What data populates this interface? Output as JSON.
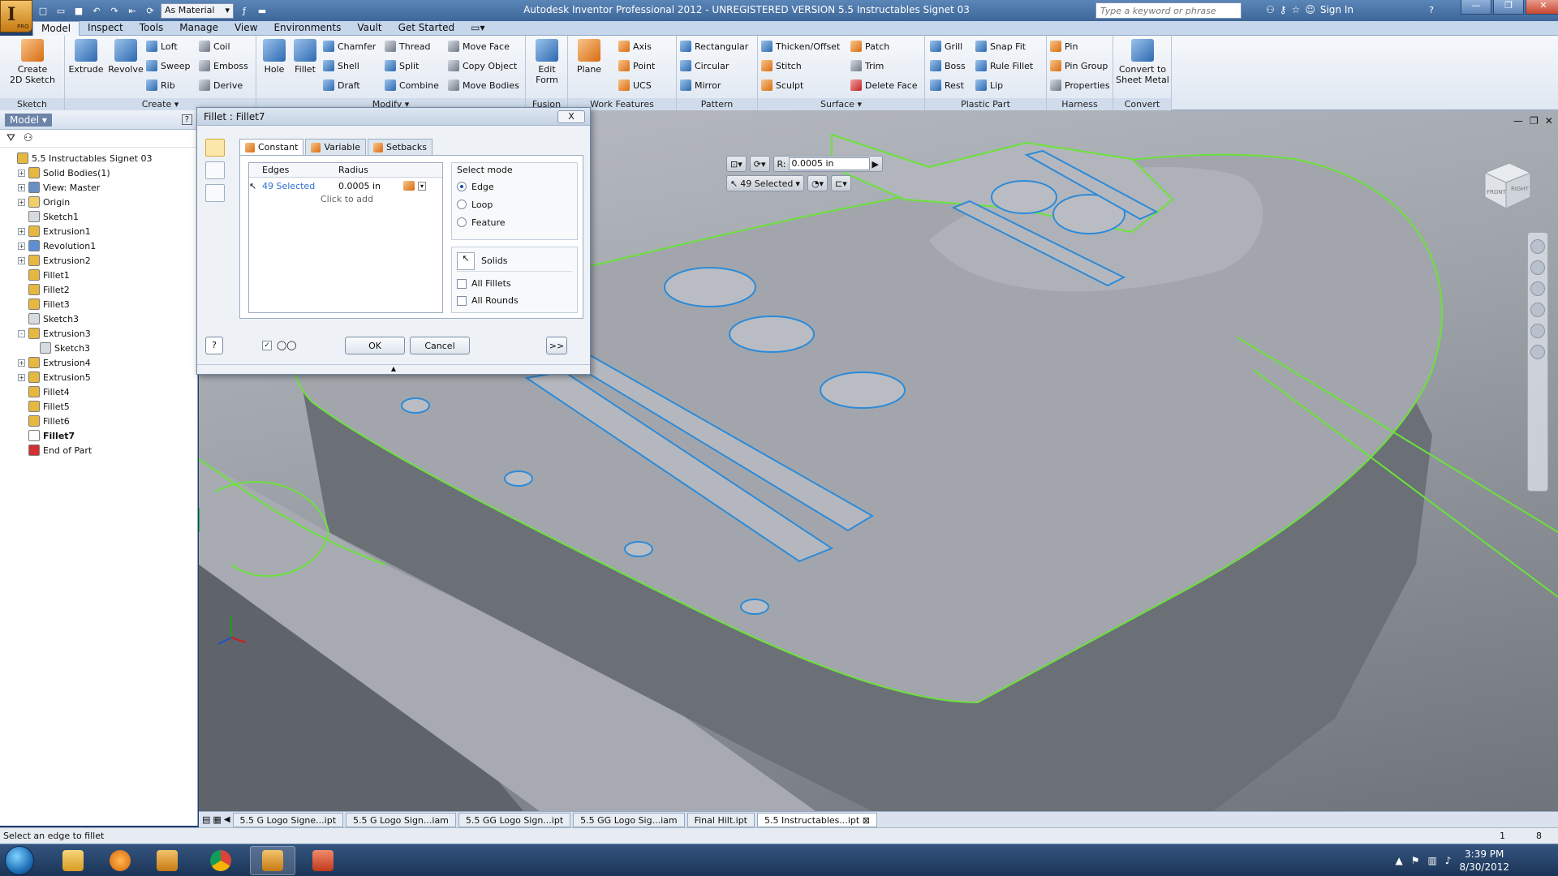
{
  "app": {
    "menu_letter": "I",
    "menu_badge": "PRO",
    "title": "Autodesk Inventor Professional 2012 - UNREGISTERED VERSION   5.5 Instructables Signet 03",
    "material": "As Material",
    "search_placeholder": "Type a keyword or phrase",
    "sign_in": "Sign In"
  },
  "ribbon_tabs": [
    "Model",
    "Inspect",
    "Tools",
    "Manage",
    "View",
    "Environments",
    "Vault",
    "Get Started"
  ],
  "ribbon": {
    "sketch": {
      "title": "Sketch",
      "create_line1": "Create",
      "create_line2": "2D Sketch"
    },
    "create": {
      "title": "Create",
      "extrude": "Extrude",
      "revolve": "Revolve",
      "loft": "Loft",
      "sweep": "Sweep",
      "rib": "Rib",
      "coil": "Coil",
      "emboss": "Emboss",
      "derive": "Derive"
    },
    "modify": {
      "title": "Modify",
      "hole": "Hole",
      "fillet": "Fillet",
      "chamfer": "Chamfer",
      "shell": "Shell",
      "draft": "Draft",
      "thread": "Thread",
      "split": "Split",
      "combine": "Combine",
      "move_face": "Move Face",
      "copy_object": "Copy Object",
      "move_bodies": "Move Bodies"
    },
    "fusion": {
      "title": "Fusion",
      "edit_form_line1": "Edit",
      "edit_form_line2": "Form"
    },
    "work_features": {
      "title": "Work Features",
      "plane": "Plane",
      "axis": "Axis",
      "point": "Point",
      "ucs": "UCS"
    },
    "pattern": {
      "title": "Pattern",
      "rectangular": "Rectangular",
      "circular": "Circular",
      "mirror": "Mirror"
    },
    "surface": {
      "title": "Surface",
      "thicken": "Thicken/Offset",
      "stitch": "Stitch",
      "sculpt": "Sculpt",
      "patch": "Patch",
      "trim": "Trim",
      "delete_face": "Delete Face"
    },
    "plastic_part": {
      "title": "Plastic Part",
      "grill": "Grill",
      "boss": "Boss",
      "rest": "Rest",
      "snap_fit": "Snap Fit",
      "rule_fillet": "Rule Fillet",
      "lip": "Lip"
    },
    "harness": {
      "title": "Harness",
      "pin": "Pin",
      "pin_group": "Pin Group",
      "properties": "Properties"
    },
    "convert": {
      "title": "Convert",
      "line1": "Convert to",
      "line2": "Sheet Metal"
    }
  },
  "browser": {
    "title": "Model",
    "tree": [
      {
        "label": "5.5 Instructables Signet 03",
        "indent": 0,
        "exp": "",
        "icon": "part-icon",
        "color": "#e6b840",
        "bold": false
      },
      {
        "label": "Solid Bodies(1)",
        "indent": 1,
        "exp": "+",
        "icon": "solid-bodies-icon",
        "color": "#e6b840",
        "bold": false
      },
      {
        "label": "View: Master",
        "indent": 1,
        "exp": "+",
        "icon": "view-icon",
        "color": "#6a8fc8",
        "bold": false
      },
      {
        "label": "Origin",
        "indent": 1,
        "exp": "+",
        "icon": "origin-folder-icon",
        "color": "#f0cf6a",
        "bold": false
      },
      {
        "label": "Sketch1",
        "indent": 1,
        "exp": "",
        "icon": "sketch-icon",
        "color": "#d6dbe2",
        "bold": false
      },
      {
        "label": "Extrusion1",
        "indent": 1,
        "exp": "+",
        "icon": "extrusion-icon",
        "color": "#e6b840",
        "bold": false
      },
      {
        "label": "Revolution1",
        "indent": 1,
        "exp": "+",
        "icon": "revolution-icon",
        "color": "#5d8fd6",
        "bold": false
      },
      {
        "label": "Extrusion2",
        "indent": 1,
        "exp": "+",
        "icon": "extrusion-icon",
        "color": "#e6b840",
        "bold": false
      },
      {
        "label": "Fillet1",
        "indent": 1,
        "exp": "",
        "icon": "fillet-icon",
        "color": "#e6b840",
        "bold": false
      },
      {
        "label": "Fillet2",
        "indent": 1,
        "exp": "",
        "icon": "fillet-icon",
        "color": "#e6b840",
        "bold": false
      },
      {
        "label": "Fillet3",
        "indent": 1,
        "exp": "",
        "icon": "fillet-icon",
        "color": "#e6b840",
        "bold": false
      },
      {
        "label": "Sketch3",
        "indent": 1,
        "exp": "",
        "icon": "sketch-icon",
        "color": "#d6dbe2",
        "bold": false
      },
      {
        "label": "Extrusion3",
        "indent": 1,
        "exp": "-",
        "icon": "extrusion-icon",
        "color": "#e6b840",
        "bold": false
      },
      {
        "label": "Sketch3",
        "indent": 2,
        "exp": "",
        "icon": "sketch-icon",
        "color": "#d6dbe2",
        "bold": false
      },
      {
        "label": "Extrusion4",
        "indent": 1,
        "exp": "+",
        "icon": "extrusion-icon",
        "color": "#e6b840",
        "bold": false
      },
      {
        "label": "Extrusion5",
        "indent": 1,
        "exp": "+",
        "icon": "extrusion-icon",
        "color": "#e6b840",
        "bold": false
      },
      {
        "label": "Fillet4",
        "indent": 1,
        "exp": "",
        "icon": "fillet-icon",
        "color": "#e6b840",
        "bold": false
      },
      {
        "label": "Fillet5",
        "indent": 1,
        "exp": "",
        "icon": "fillet-icon",
        "color": "#e6b840",
        "bold": false
      },
      {
        "label": "Fillet6",
        "indent": 1,
        "exp": "",
        "icon": "fillet-icon",
        "color": "#e6b840",
        "bold": false
      },
      {
        "label": "Fillet7",
        "indent": 1,
        "exp": "",
        "icon": "fillet-icon",
        "color": "#ffffff",
        "bold": true
      },
      {
        "label": "End of Part",
        "indent": 1,
        "exp": "",
        "icon": "end-of-part-icon",
        "color": "#d23030",
        "bold": false
      }
    ]
  },
  "mini_toolbar": {
    "radius_label": "R:",
    "radius_value": "0.0005 in",
    "selected": "49 Selected"
  },
  "viewcube": {
    "front": "FRONT",
    "right": "RIGHT"
  },
  "dialog": {
    "title": "Fillet : Fillet7",
    "close": "X",
    "tabs": [
      "Constant",
      "Variable",
      "Setbacks"
    ],
    "col_edges": "Edges",
    "col_radius": "Radius",
    "edges_value": "49 Selected",
    "radius_value": "0.0005 in",
    "click_to_add": "Click to add",
    "select_mode": "Select mode",
    "mode_edge": "Edge",
    "mode_loop": "Loop",
    "mode_feature": "Feature",
    "solids": "Solids",
    "all_fillets": "All Fillets",
    "all_rounds": "All Rounds",
    "ok": "OK",
    "cancel": "Cancel",
    "more": ">>"
  },
  "doc_tabs": [
    "5.5 G Logo Signe...ipt",
    "5.5 G Logo Sign...iam",
    "5.5 GG Logo Sign...ipt",
    "5.5 GG Logo Sig...iam",
    "Final Hilt.ipt",
    "5.5 Instructables...ipt"
  ],
  "status": {
    "prompt": "Select an edge to fillet",
    "n1": "1",
    "n2": "8"
  },
  "taskbar": {
    "time": "3:39 PM",
    "date": "8/30/2012"
  },
  "colors": {
    "selection_green": "#6be23a",
    "highlight_blue": "#2c8ad8",
    "titlebar": "#4a74a8"
  }
}
